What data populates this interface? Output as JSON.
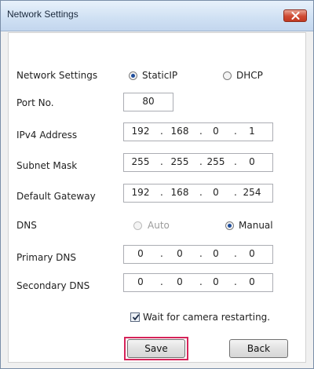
{
  "window": {
    "title": "Network Settings"
  },
  "rows": {
    "network_settings": {
      "label": "Network Settings",
      "option_static": "StaticIP",
      "option_dhcp": "DHCP",
      "selected": "StaticIP"
    },
    "port": {
      "label": "Port No.",
      "value": "80"
    },
    "ipv4": {
      "label": "IPv4 Address",
      "octets": [
        "192",
        "168",
        "0",
        "1"
      ]
    },
    "subnet": {
      "label": "Subnet Mask",
      "octets": [
        "255",
        "255",
        "255",
        "0"
      ]
    },
    "gateway": {
      "label": "Default Gateway",
      "octets": [
        "192",
        "168",
        "0",
        "254"
      ]
    },
    "dns": {
      "label": "DNS",
      "option_auto": "Auto",
      "option_manual": "Manual",
      "selected": "Manual"
    },
    "primary_dns": {
      "label": "Primary DNS",
      "octets": [
        "0",
        "0",
        "0",
        "0"
      ]
    },
    "secondary_dns": {
      "label": "Secondary DNS",
      "octets": [
        "0",
        "0",
        "0",
        "0"
      ]
    }
  },
  "wait_checkbox": {
    "label": "Wait for camera restarting.",
    "checked": true
  },
  "buttons": {
    "save": "Save",
    "back": "Back"
  },
  "colors": {
    "focus_border": "#d6245a",
    "title_bar": "#cfe0f3",
    "close_button": "#cf4a32"
  },
  "icons": {
    "close": "close-x-icon",
    "check": "checkmark-icon"
  }
}
